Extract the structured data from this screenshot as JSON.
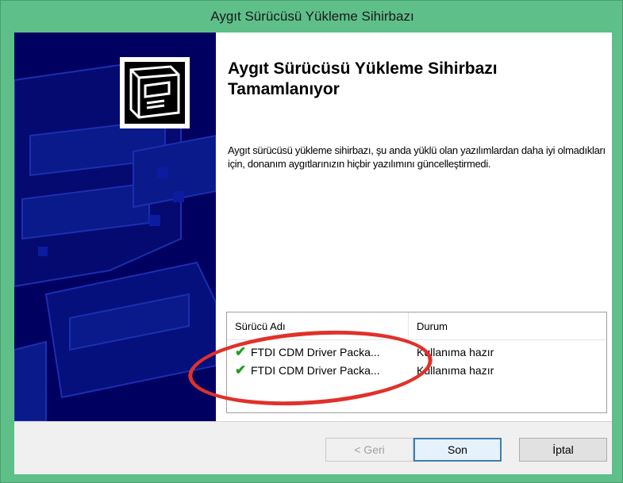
{
  "window": {
    "title": "Aygıt Sürücüsü Yükleme Sihirbazı"
  },
  "main": {
    "heading": "Aygıt Sürücüsü Yükleme Sihirbazı Tamamlanıyor",
    "description": "Aygıt sürücüsü yükleme sihirbazı, şu anda yüklü olan yazılımlardan daha iyi olmadıkları için, donanım aygıtlarınızın hiçbir yazılımını güncelleştirmedi."
  },
  "driver_list": {
    "columns": [
      "Sürücü Adı",
      "Durum"
    ],
    "rows": [
      {
        "name": "FTDI CDM Driver Packa...",
        "status": "Kullanıma hazır",
        "icon": "checkmark-icon"
      },
      {
        "name": "FTDI CDM Driver Packa...",
        "status": "Kullanıma hazır",
        "icon": "checkmark-icon"
      }
    ]
  },
  "buttons": {
    "back": "< Geri",
    "finish": "Son",
    "cancel": "İptal"
  },
  "colors": {
    "titlebar": "#5fbf89",
    "sidebar": "#000060",
    "highlight_ellipse": "#e0312a",
    "check": "#1f9e1f"
  }
}
